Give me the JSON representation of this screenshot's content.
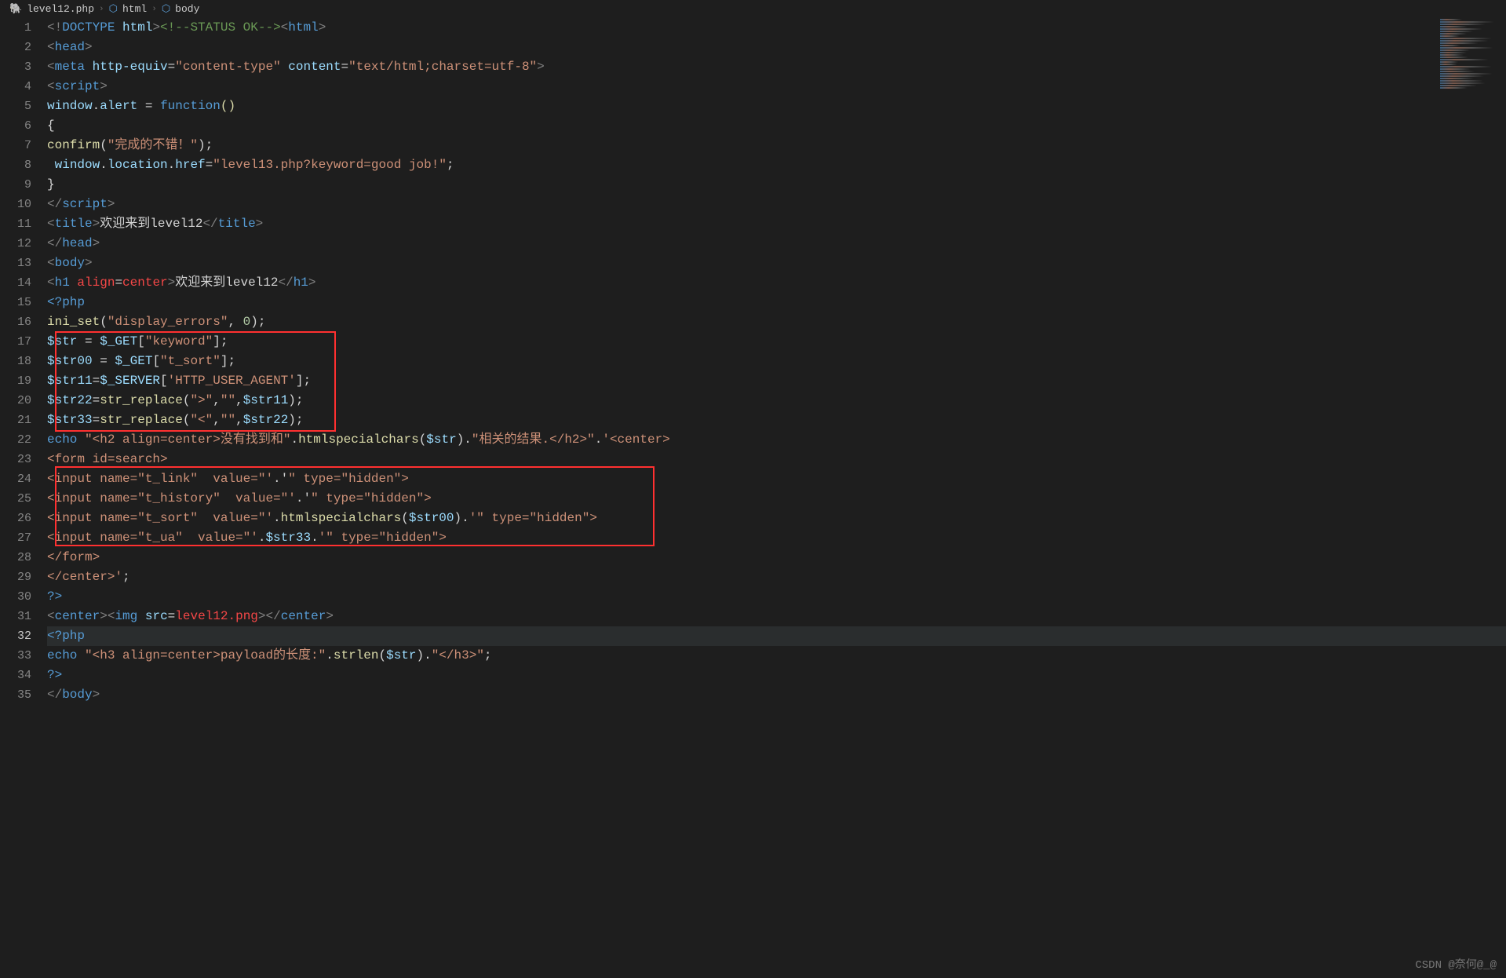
{
  "breadcrumb": {
    "file": "level12.php",
    "path1": "html",
    "path2": "body"
  },
  "code": {
    "lines": [
      {
        "n": 1,
        "tokens": [
          [
            "gray",
            "<!"
          ],
          [
            "blue",
            "DOCTYPE"
          ],
          [
            "white",
            " "
          ],
          [
            "lblue",
            "html"
          ],
          [
            "gray",
            ">"
          ],
          [
            "green",
            "<!--STATUS OK-->"
          ],
          [
            "gray",
            "<"
          ],
          [
            "blue",
            "html"
          ],
          [
            "gray",
            ">"
          ]
        ]
      },
      {
        "n": 2,
        "tokens": [
          [
            "gray",
            "<"
          ],
          [
            "blue",
            "head"
          ],
          [
            "gray",
            ">"
          ]
        ]
      },
      {
        "n": 3,
        "tokens": [
          [
            "gray",
            "<"
          ],
          [
            "blue",
            "meta"
          ],
          [
            "white",
            " "
          ],
          [
            "lblue",
            "http-equiv"
          ],
          [
            "white",
            "="
          ],
          [
            "orange",
            "\"content-type\""
          ],
          [
            "white",
            " "
          ],
          [
            "lblue",
            "content"
          ],
          [
            "white",
            "="
          ],
          [
            "orange",
            "\"text/html;charset=utf-8\""
          ],
          [
            "gray",
            ">"
          ]
        ]
      },
      {
        "n": 4,
        "tokens": [
          [
            "gray",
            "<"
          ],
          [
            "blue",
            "script"
          ],
          [
            "gray",
            ">"
          ]
        ]
      },
      {
        "n": 5,
        "tokens": [
          [
            "lblue",
            "window"
          ],
          [
            "white",
            "."
          ],
          [
            "lblue",
            "alert"
          ],
          [
            "white",
            " "
          ],
          [
            "white",
            "="
          ],
          [
            "white",
            " "
          ],
          [
            "blue",
            "function"
          ],
          [
            "yellow",
            "()"
          ]
        ]
      },
      {
        "n": 6,
        "tokens": [
          [
            "white",
            "{"
          ]
        ]
      },
      {
        "n": 7,
        "tokens": [
          [
            "yellow",
            "confirm"
          ],
          [
            "white",
            "("
          ],
          [
            "orange",
            "\"完成的不错！\""
          ],
          [
            "white",
            ");"
          ]
        ]
      },
      {
        "n": 8,
        "tokens": [
          [
            "white",
            " "
          ],
          [
            "lblue",
            "window"
          ],
          [
            "white",
            "."
          ],
          [
            "lblue",
            "location"
          ],
          [
            "white",
            "."
          ],
          [
            "lblue",
            "href"
          ],
          [
            "white",
            "="
          ],
          [
            "orange",
            "\"level13.php?keyword=good job!\""
          ],
          [
            "white",
            ";"
          ]
        ]
      },
      {
        "n": 9,
        "tokens": [
          [
            "white",
            "}"
          ]
        ]
      },
      {
        "n": 10,
        "tokens": [
          [
            "gray",
            "</"
          ],
          [
            "blue",
            "script"
          ],
          [
            "gray",
            ">"
          ]
        ]
      },
      {
        "n": 11,
        "tokens": [
          [
            "gray",
            "<"
          ],
          [
            "blue",
            "title"
          ],
          [
            "gray",
            ">"
          ],
          [
            "white",
            "欢迎来到level12"
          ],
          [
            "gray",
            "</"
          ],
          [
            "blue",
            "title"
          ],
          [
            "gray",
            ">"
          ]
        ]
      },
      {
        "n": 12,
        "tokens": [
          [
            "gray",
            "</"
          ],
          [
            "blue",
            "head"
          ],
          [
            "gray",
            ">"
          ]
        ]
      },
      {
        "n": 13,
        "tokens": [
          [
            "gray",
            "<"
          ],
          [
            "blue",
            "body"
          ],
          [
            "gray",
            ">"
          ]
        ]
      },
      {
        "n": 14,
        "tokens": [
          [
            "gray",
            "<"
          ],
          [
            "blue",
            "h1"
          ],
          [
            "white",
            " "
          ],
          [
            "red",
            "align"
          ],
          [
            "white",
            "="
          ],
          [
            "red",
            "center"
          ],
          [
            "gray",
            ">"
          ],
          [
            "white",
            "欢迎来到level12"
          ],
          [
            "gray",
            "</"
          ],
          [
            "blue",
            "h1"
          ],
          [
            "gray",
            ">"
          ]
        ]
      },
      {
        "n": 15,
        "tokens": [
          [
            "blue",
            "<?php"
          ]
        ]
      },
      {
        "n": 16,
        "tokens": [
          [
            "yellow",
            "ini_set"
          ],
          [
            "white",
            "("
          ],
          [
            "orange",
            "\"display_errors\""
          ],
          [
            "white",
            ", "
          ],
          [
            "num",
            "0"
          ],
          [
            "white",
            ");"
          ]
        ]
      },
      {
        "n": 17,
        "tokens": [
          [
            "lblue",
            "$str"
          ],
          [
            "white",
            " = "
          ],
          [
            "lblue",
            "$_GET"
          ],
          [
            "white",
            "["
          ],
          [
            "orange",
            "\"keyword\""
          ],
          [
            "white",
            "];"
          ]
        ]
      },
      {
        "n": 18,
        "tokens": [
          [
            "lblue",
            "$str00"
          ],
          [
            "white",
            " = "
          ],
          [
            "lblue",
            "$_GET"
          ],
          [
            "white",
            "["
          ],
          [
            "orange",
            "\"t_sort\""
          ],
          [
            "white",
            "];"
          ]
        ]
      },
      {
        "n": 19,
        "tokens": [
          [
            "lblue",
            "$str11"
          ],
          [
            "white",
            "="
          ],
          [
            "lblue",
            "$_SERVER"
          ],
          [
            "white",
            "["
          ],
          [
            "orange",
            "'HTTP_USER_AGENT'"
          ],
          [
            "white",
            "];"
          ]
        ]
      },
      {
        "n": 20,
        "tokens": [
          [
            "lblue",
            "$str22"
          ],
          [
            "white",
            "="
          ],
          [
            "yellow",
            "str_replace"
          ],
          [
            "white",
            "("
          ],
          [
            "orange",
            "\">\""
          ],
          [
            "white",
            ","
          ],
          [
            "orange",
            "\"\""
          ],
          [
            "white",
            ","
          ],
          [
            "lblue",
            "$str11"
          ],
          [
            "white",
            ");"
          ]
        ]
      },
      {
        "n": 21,
        "tokens": [
          [
            "lblue",
            "$str33"
          ],
          [
            "white",
            "="
          ],
          [
            "yellow",
            "str_replace"
          ],
          [
            "white",
            "("
          ],
          [
            "orange",
            "\"<\""
          ],
          [
            "white",
            ","
          ],
          [
            "orange",
            "\"\""
          ],
          [
            "white",
            ","
          ],
          [
            "lblue",
            "$str22"
          ],
          [
            "white",
            ");"
          ]
        ]
      },
      {
        "n": 22,
        "tokens": [
          [
            "blue",
            "echo"
          ],
          [
            "white",
            " "
          ],
          [
            "orange",
            "\"<h2 align=center>没有找到和\""
          ],
          [
            "white",
            "."
          ],
          [
            "yellow",
            "htmlspecialchars"
          ],
          [
            "white",
            "("
          ],
          [
            "lblue",
            "$str"
          ],
          [
            "white",
            ")."
          ],
          [
            "orange",
            "\"相关的结果.</h2>\""
          ],
          [
            "white",
            "."
          ],
          [
            "orange",
            "'<center>"
          ]
        ]
      },
      {
        "n": 23,
        "tokens": [
          [
            "orange",
            "<form id=search>"
          ]
        ]
      },
      {
        "n": 24,
        "tokens": [
          [
            "orange",
            "<input name=\"t_link\"  value=\"'"
          ],
          [
            "white",
            ".'"
          ],
          [
            "orange",
            "\" type=\"hidden\">"
          ]
        ]
      },
      {
        "n": 25,
        "tokens": [
          [
            "orange",
            "<input name=\"t_history\"  value=\"'"
          ],
          [
            "white",
            ".'"
          ],
          [
            "orange",
            "\" type=\"hidden\">"
          ]
        ]
      },
      {
        "n": 26,
        "tokens": [
          [
            "orange",
            "<input name=\"t_sort\"  value=\"'"
          ],
          [
            "white",
            "."
          ],
          [
            "yellow",
            "htmlspecialchars"
          ],
          [
            "white",
            "("
          ],
          [
            "lblue",
            "$str00"
          ],
          [
            "white",
            ")."
          ],
          [
            "orange",
            "'\" type=\"hidden\">"
          ]
        ]
      },
      {
        "n": 27,
        "tokens": [
          [
            "orange",
            "<input name=\"t_ua\"  value=\"'"
          ],
          [
            "white",
            "."
          ],
          [
            "lblue",
            "$str33"
          ],
          [
            "white",
            "."
          ],
          [
            "orange",
            "'\" type=\"hidden\">"
          ]
        ]
      },
      {
        "n": 28,
        "tokens": [
          [
            "orange",
            "</form>"
          ]
        ]
      },
      {
        "n": 29,
        "tokens": [
          [
            "orange",
            "</center>'"
          ],
          [
            "white",
            ";"
          ]
        ]
      },
      {
        "n": 30,
        "tokens": [
          [
            "blue",
            "?>"
          ]
        ]
      },
      {
        "n": 31,
        "tokens": [
          [
            "gray",
            "<"
          ],
          [
            "blue",
            "center"
          ],
          [
            "gray",
            ">"
          ],
          [
            "gray",
            "<"
          ],
          [
            "blue",
            "img"
          ],
          [
            "white",
            " "
          ],
          [
            "lblue",
            "src"
          ],
          [
            "white",
            "="
          ],
          [
            "red",
            "level12.png"
          ],
          [
            "gray",
            ">"
          ],
          [
            "gray",
            "</"
          ],
          [
            "blue",
            "center"
          ],
          [
            "gray",
            ">"
          ]
        ]
      },
      {
        "n": 32,
        "tokens": [
          [
            "blue",
            "<?php"
          ]
        ],
        "active": true
      },
      {
        "n": 33,
        "tokens": [
          [
            "blue",
            "echo"
          ],
          [
            "white",
            " "
          ],
          [
            "orange",
            "\"<h3 align=center>payload的长度:\""
          ],
          [
            "white",
            "."
          ],
          [
            "yellow",
            "strlen"
          ],
          [
            "white",
            "("
          ],
          [
            "lblue",
            "$str"
          ],
          [
            "white",
            ")."
          ],
          [
            "orange",
            "\"</h3>\""
          ],
          [
            "white",
            ";"
          ]
        ]
      },
      {
        "n": 34,
        "tokens": [
          [
            "blue",
            "?>"
          ]
        ]
      },
      {
        "n": 35,
        "tokens": [
          [
            "gray",
            "</"
          ],
          [
            "blue",
            "body"
          ],
          [
            "gray",
            ">"
          ]
        ]
      }
    ]
  },
  "watermark": "CSDN @奈何@_@"
}
